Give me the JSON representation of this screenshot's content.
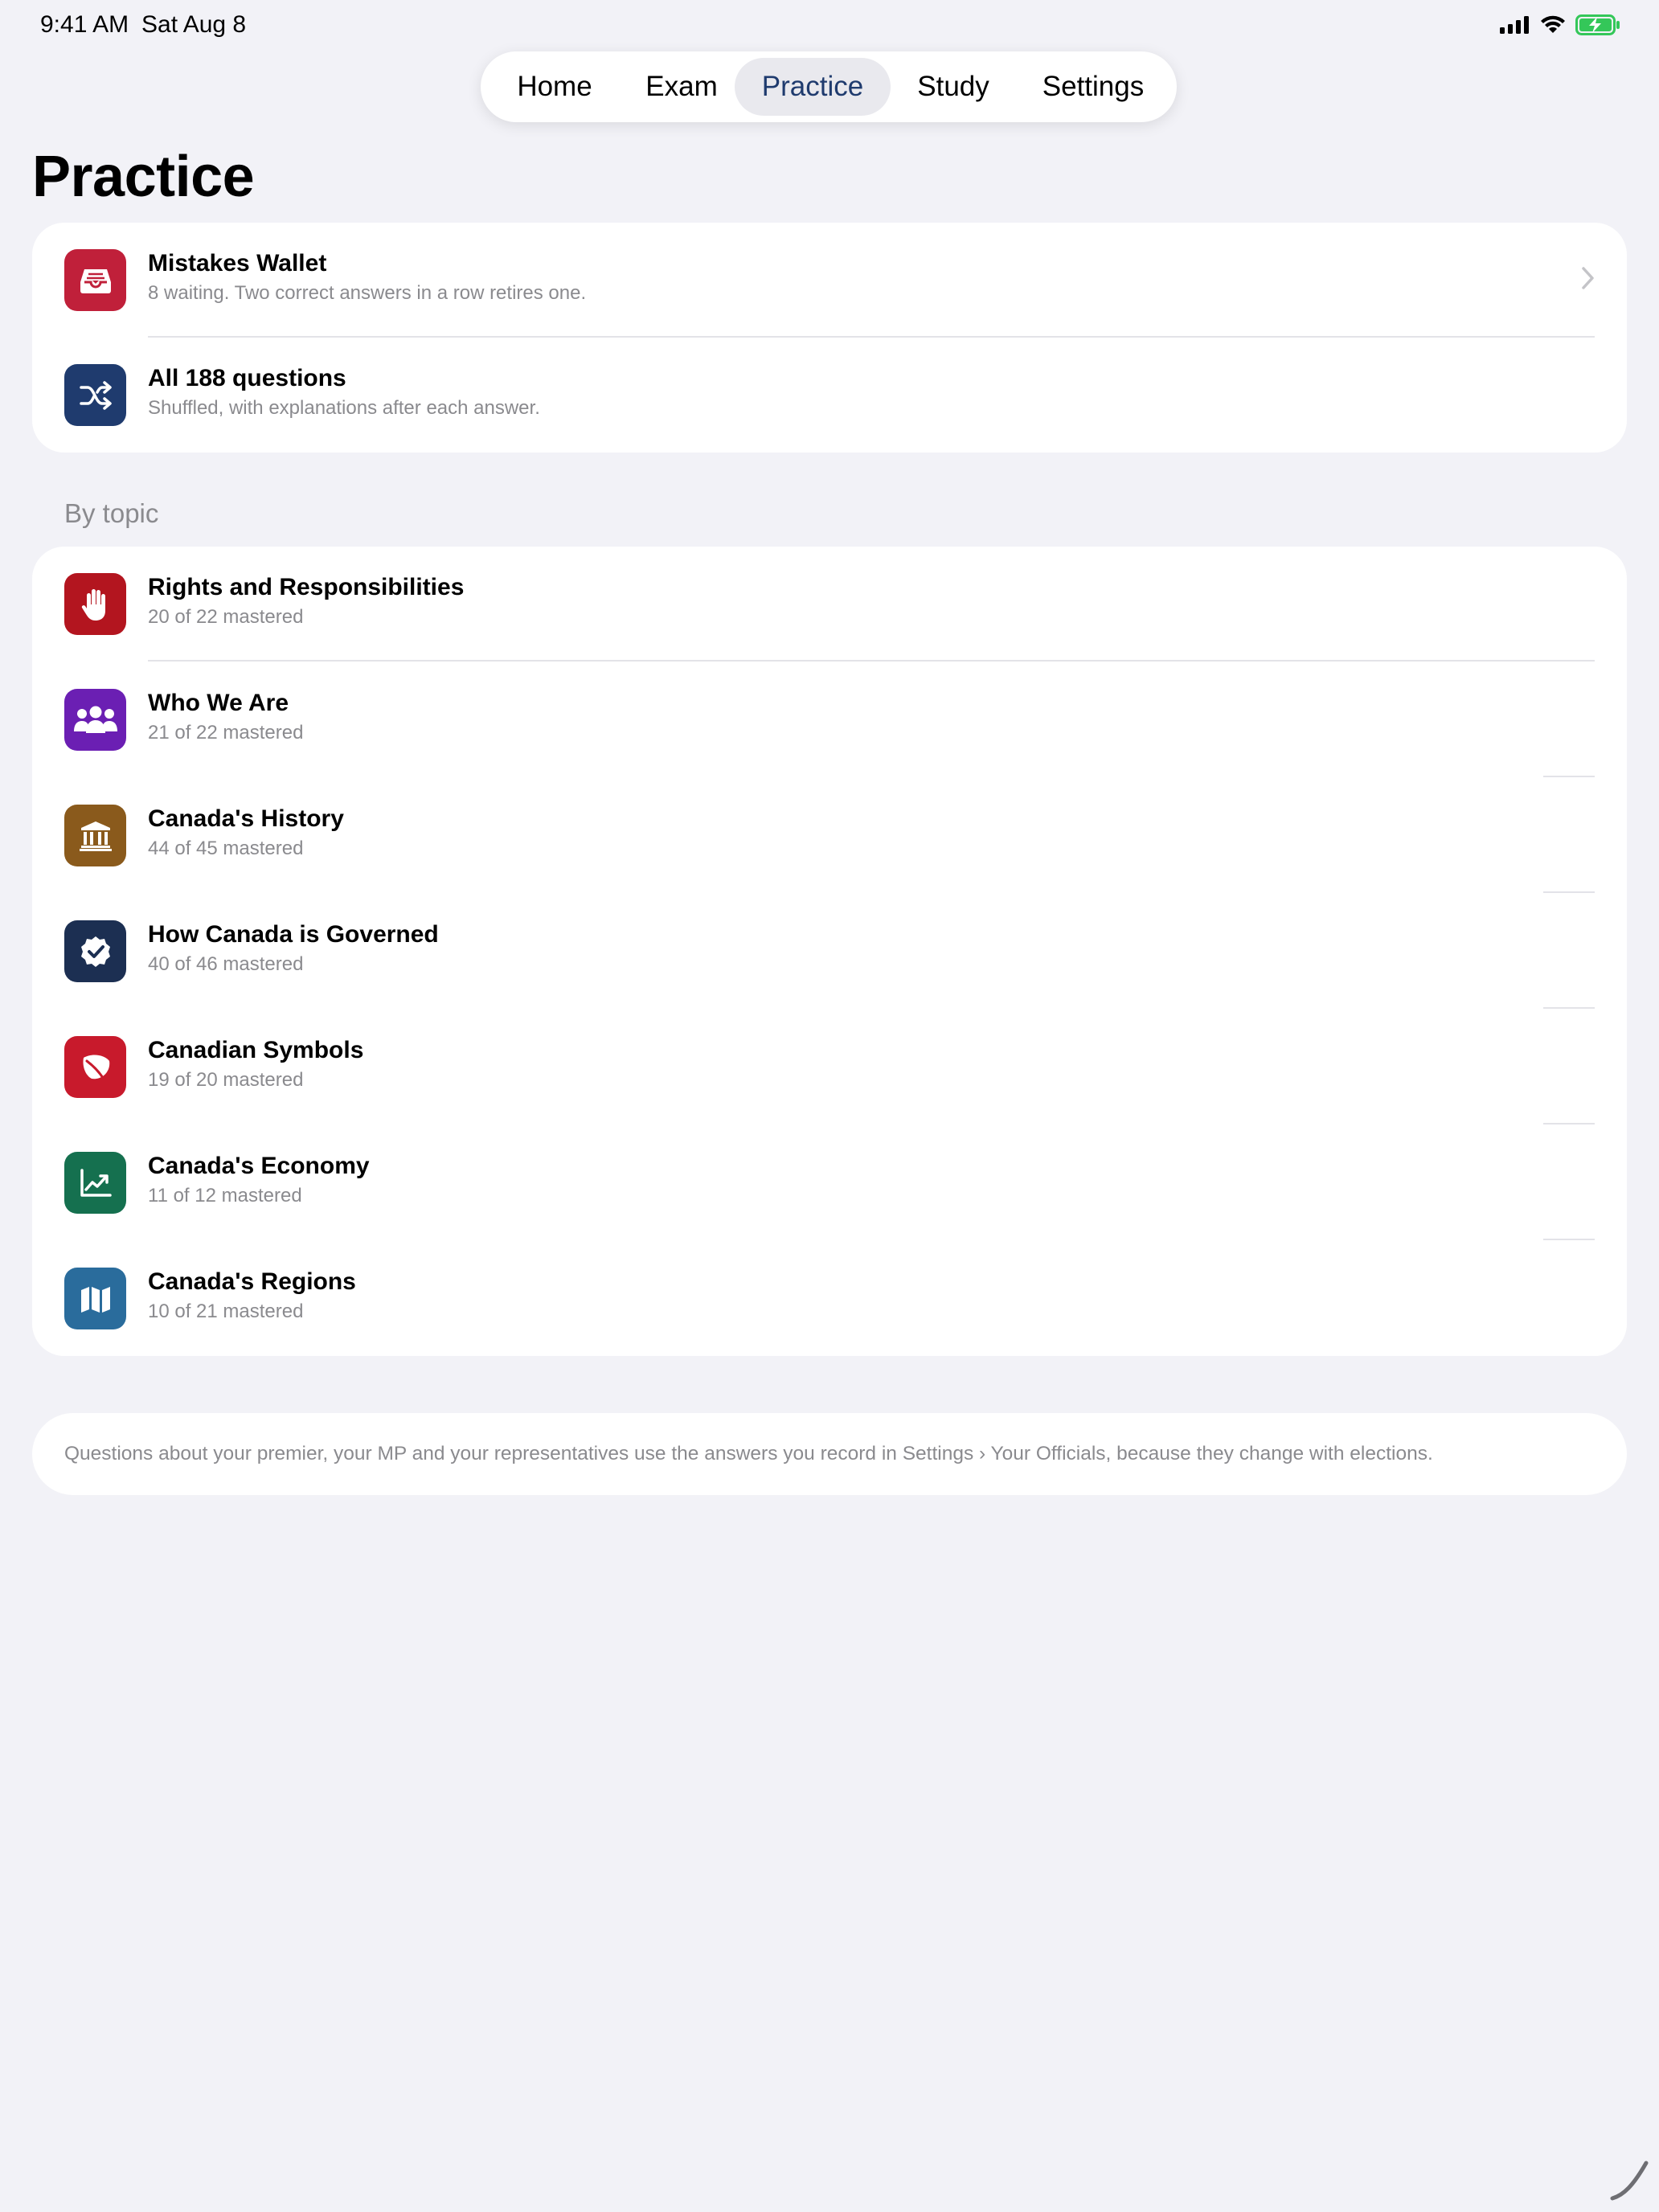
{
  "status_bar": {
    "time": "9:41 AM",
    "date": "Sat Aug 8"
  },
  "tabs": [
    {
      "label": "Home"
    },
    {
      "label": "Exam"
    },
    {
      "label": "Practice"
    },
    {
      "label": "Study"
    },
    {
      "label": "Settings"
    }
  ],
  "selected_tab": "Practice",
  "page": {
    "title": "Practice"
  },
  "quick_actions": [
    {
      "title": "Mistakes Wallet",
      "subtitle": "8 waiting. Two correct answers in a row retires one.",
      "icon": "tray-icon",
      "color": "#c0203a"
    },
    {
      "title": "All 188 questions",
      "subtitle": "Shuffled, with explanations after each answer.",
      "icon": "shuffle-icon",
      "color": "#1f3b6e"
    }
  ],
  "by_topic": {
    "header": "By topic",
    "items": [
      {
        "title": "Rights and Responsibilities",
        "subtitle": "20 of 22 mastered",
        "icon": "hand-icon",
        "color": "#b3151f"
      },
      {
        "title": "Who We Are",
        "subtitle": "21 of 22 mastered",
        "icon": "people-icon",
        "color": "#6b1fb3"
      },
      {
        "title": "Canada's History",
        "subtitle": "44 of 45 mastered",
        "icon": "building-columns-icon",
        "color": "#8a5a1c"
      },
      {
        "title": "How Canada is Governed",
        "subtitle": "40 of 46 mastered",
        "icon": "checkmark-seal-icon",
        "color": "#1c2f52"
      },
      {
        "title": "Canadian Symbols",
        "subtitle": "19 of 20 mastered",
        "icon": "leaf-icon",
        "color": "#c81a2c"
      },
      {
        "title": "Canada's Economy",
        "subtitle": "11 of 12 mastered",
        "icon": "chart-line-uptrend-icon",
        "color": "#15704f"
      },
      {
        "title": "Canada's Regions",
        "subtitle": "10 of 21 mastered",
        "icon": "map-icon",
        "color": "#2a6c9c"
      }
    ]
  },
  "footnote": "Questions about your premier, your MP and your representatives use the answers you record in Settings › Your Officials, because they change with elections."
}
